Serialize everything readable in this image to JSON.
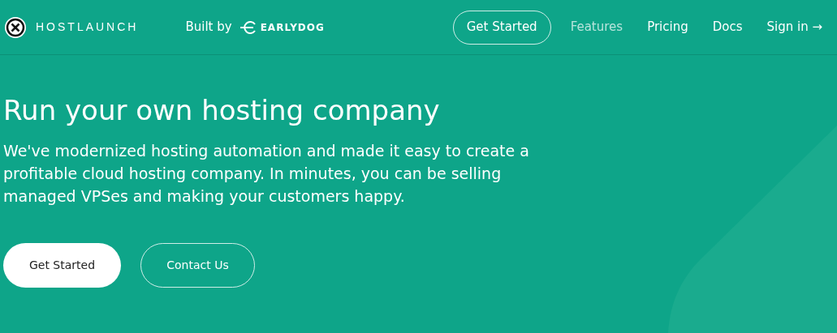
{
  "header": {
    "brand": "HOSTLAUNCH",
    "built_by": "Built by",
    "partner": "EARLYDOG",
    "cta": "Get Started",
    "nav": [
      {
        "label": "Features",
        "selected": true
      },
      {
        "label": "Pricing",
        "selected": false
      },
      {
        "label": "Docs",
        "selected": false
      },
      {
        "label": "Sign in →",
        "selected": false
      }
    ]
  },
  "hero": {
    "title": "Run your own hosting company",
    "text": "We've modernized hosting automation and made it easy to create a profitable cloud hosting company. In minutes, you can be selling managed VPSes and making your customers happy.",
    "buttons": [
      {
        "label": "Get Started",
        "kind": "primary"
      },
      {
        "label": "Contact Us",
        "kind": "outline"
      }
    ]
  }
}
